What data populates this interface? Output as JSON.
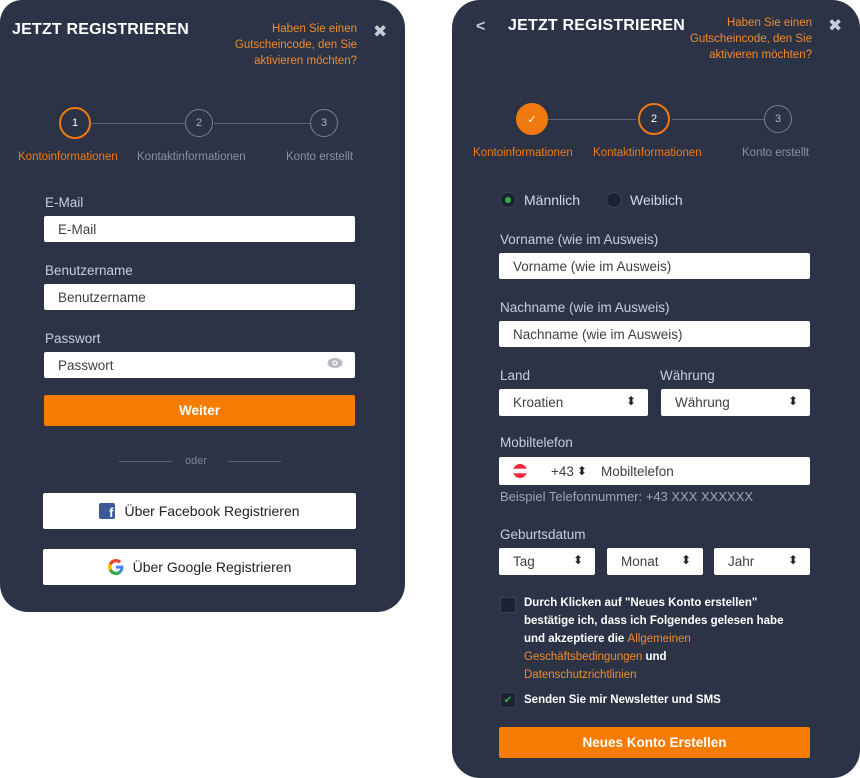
{
  "left": {
    "title": "JETZT REGISTRIEREN",
    "promo_line1": "Haben Sie einen",
    "promo_line2": "Gutscheincode, den Sie",
    "promo_line3": "aktivieren möchten?",
    "close": "✖",
    "steps": [
      {
        "number": "1",
        "label": "Kontoinformationen"
      },
      {
        "number": "2",
        "label": "Kontaktinformationen"
      },
      {
        "number": "3",
        "label": "Konto erstellt"
      }
    ],
    "email_label": "E-Mail",
    "email_placeholder": "E-Mail",
    "username_label": "Benutzername",
    "username_placeholder": "Benutzername",
    "password_label": "Passwort",
    "password_placeholder": "Passwort",
    "next_button": "Weiter",
    "or_text": "oder",
    "facebook_button": "Über Facebook Registrieren",
    "google_button": "Über Google Registrieren"
  },
  "right": {
    "back": "<",
    "title": "JETZT REGISTRIEREN",
    "promo_line1": "Haben Sie einen",
    "promo_line2": "Gutscheincode, den Sie",
    "promo_line3": "aktivieren möchten?",
    "close": "✖",
    "steps": [
      {
        "number": "✓",
        "label": "Kontoinformationen"
      },
      {
        "number": "2",
        "label": "Kontaktinformationen"
      },
      {
        "number": "3",
        "label": "Konto erstellt"
      }
    ],
    "gender_male": "Männlich",
    "gender_female": "Weiblich",
    "firstname_label": "Vorname (wie im Ausweis)",
    "firstname_placeholder": "Vorname (wie im Ausweis)",
    "lastname_label": "Nachname (wie im Ausweis)",
    "lastname_placeholder": "Nachname (wie im Ausweis)",
    "country_label": "Land",
    "country_value": "Kroatien",
    "currency_label": "Währung",
    "currency_value": "Währung",
    "mobile_label": "Mobiltelefon",
    "dial_code": "+43",
    "mobile_placeholder": "Mobiltelefon",
    "phone_example": "Beispiel Telefonnummer: +43 XXX XXXXXX",
    "dob_label": "Geburtsdatum",
    "day": "Tag",
    "month": "Monat",
    "year": "Jahr",
    "terms_text1": "Durch Klicken auf \"Neues Konto erstellen\"",
    "terms_text2": "bestätige ich, dass ich Folgendes gelesen habe",
    "terms_text3": "und akzeptiere die ",
    "terms_link1a": "Allgemeinen",
    "terms_link1b": "Geschäftsbedingungen",
    "terms_and": " und",
    "terms_link2": "Datenschutzrichtlinien",
    "newsletter": "Senden Sie mir Newsletter und SMS",
    "submit_button": "Neues Konto Erstellen"
  },
  "colors": {
    "panel": "#2c3346",
    "accent": "#f57c00",
    "check_green": "#2fb34f"
  }
}
